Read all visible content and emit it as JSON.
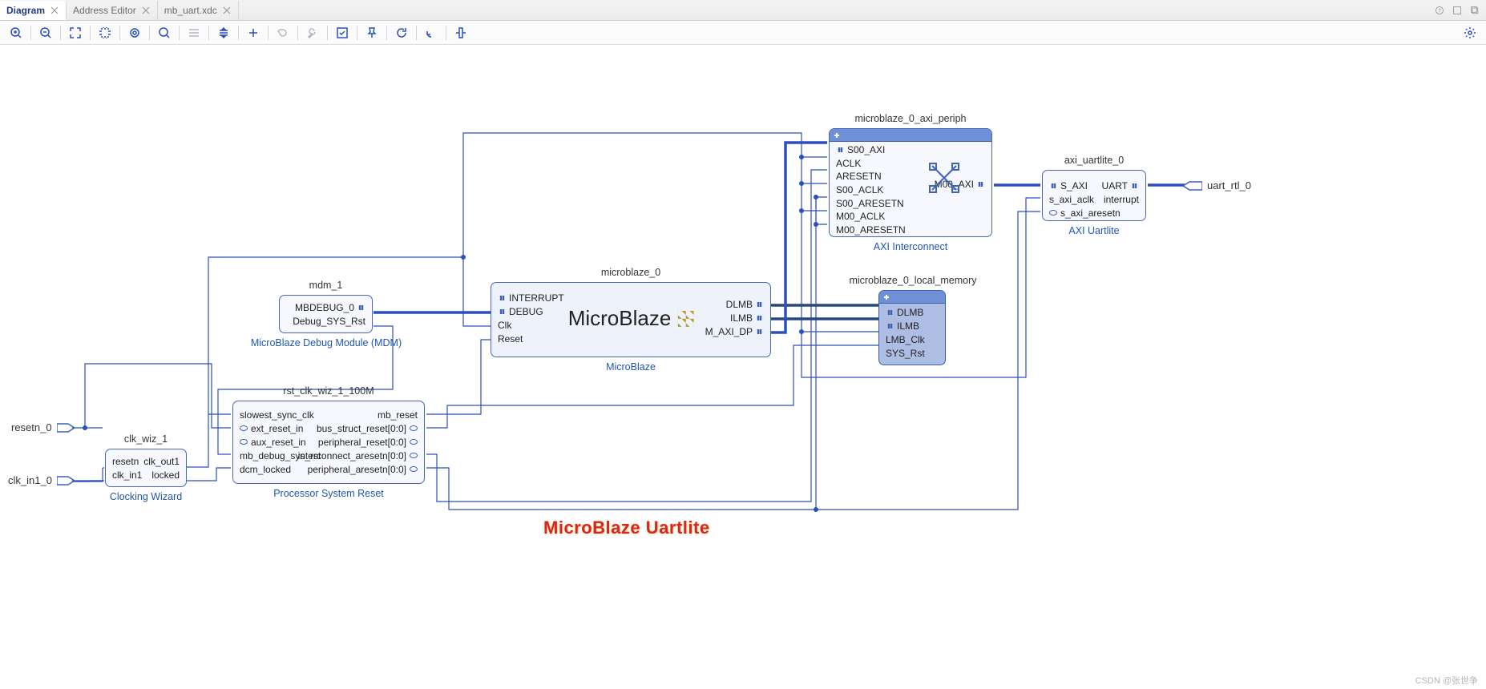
{
  "tabs": {
    "items": [
      {
        "label": "Diagram",
        "active": true
      },
      {
        "label": "Address Editor",
        "active": false
      },
      {
        "label": "mb_uart.xdc",
        "active": false
      }
    ]
  },
  "toolbar": {
    "buttons": [
      "zoom-in",
      "zoom-out",
      "fit",
      "fit-area",
      "auto-fit",
      "search",
      "hlines",
      "vlines",
      "add",
      "undo",
      "settings",
      "checkbox",
      "pin",
      "refresh",
      "route",
      "align"
    ]
  },
  "overlay": {
    "title": "MicroBlaze Uartlite"
  },
  "watermark": {
    "text": "CSDN @张世争"
  },
  "external_ports": {
    "left": [
      {
        "name": "resetn_0"
      },
      {
        "name": "clk_in1_0"
      }
    ],
    "right": [
      {
        "name": "uart_rtl_0"
      }
    ]
  },
  "blocks": {
    "clk_wiz": {
      "instance": "clk_wiz_1",
      "footer": "Clocking Wizard",
      "left": [
        "resetn",
        "clk_in1"
      ],
      "right": [
        "clk_out1",
        "locked"
      ]
    },
    "rst": {
      "instance": "rst_clk_wiz_1_100M",
      "footer": "Processor System Reset",
      "left": [
        "slowest_sync_clk",
        "ext_reset_in",
        "aux_reset_in",
        "mb_debug_sys_rst",
        "dcm_locked"
      ],
      "right": [
        "mb_reset",
        "bus_struct_reset[0:0]",
        "peripheral_reset[0:0]",
        "interconnect_aresetn[0:0]",
        "peripheral_aresetn[0:0]"
      ]
    },
    "mdm": {
      "instance": "mdm_1",
      "footer": "MicroBlaze Debug Module (MDM)",
      "right": [
        "MBDEBUG_0",
        "Debug_SYS_Rst"
      ]
    },
    "mb": {
      "instance": "microblaze_0",
      "footer": "MicroBlaze",
      "logo": "MicroBlaze",
      "left": [
        "INTERRUPT",
        "DEBUG",
        "Clk",
        "Reset"
      ],
      "right": [
        "DLMB",
        "ILMB",
        "M_AXI_DP"
      ]
    },
    "axi": {
      "instance": "microblaze_0_axi_periph",
      "footer": "AXI Interconnect",
      "left": [
        "S00_AXI",
        "ACLK",
        "ARESETN",
        "S00_ACLK",
        "S00_ARESETN",
        "M00_ACLK",
        "M00_ARESETN"
      ],
      "right": [
        "M00_AXI"
      ]
    },
    "mem": {
      "instance": "microblaze_0_local_memory",
      "left": [
        "DLMB",
        "ILMB",
        "LMB_Clk",
        "SYS_Rst"
      ]
    },
    "uart": {
      "instance": "axi_uartlite_0",
      "footer": "AXI Uartlite",
      "left": [
        "S_AXI",
        "s_axi_aclk",
        "s_axi_aresetn"
      ],
      "right": [
        "UART",
        "interrupt"
      ]
    }
  }
}
